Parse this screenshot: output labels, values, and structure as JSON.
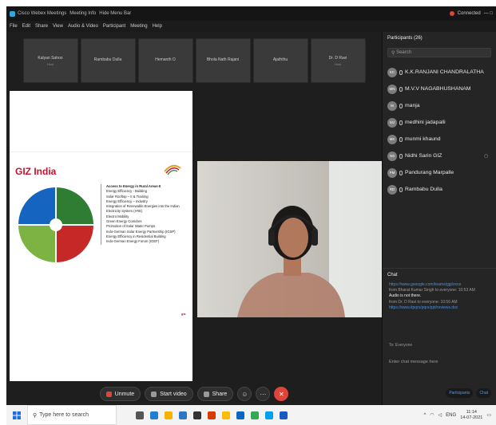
{
  "titlebar": {
    "app_title": "Cisco Webex Meetings",
    "meeting_info": "Meeting Info",
    "hide_menu": "Hide Menu Bar",
    "status": "Connected",
    "controls": "—  □"
  },
  "menu": [
    "File",
    "Edit",
    "Share",
    "View",
    "Audio & Video",
    "Participant",
    "Meeting",
    "Help"
  ],
  "tiles": [
    {
      "name": "Kalyan Sahoo",
      "sub": "Host"
    },
    {
      "name": "Rambabu Dulla",
      "sub": ""
    },
    {
      "name": "Hemanth O",
      "sub": ""
    },
    {
      "name": "Bhola Nath Rajani",
      "sub": ""
    },
    {
      "name": "Ajaththu",
      "sub": ""
    },
    {
      "name": "Dr. D Ravi",
      "sub": "Host"
    }
  ],
  "slide": {
    "title": "GIZ India",
    "bullets": [
      "Access to Energy in Rural Areas-II",
      "Energy Efficiency - Building",
      "Solar Rooftop – II & Training",
      "Energy Efficiency – Industry",
      "Integration of Renewable Energies into the Indian",
      "Electricity System (I-RE)",
      "Electro Mobility",
      "Green Energy Corridors",
      "Promotion of Solar Water Pumps",
      "Indo-German Solar Energy Partnership (IGSP)",
      "Energy Efficiency in Residential Building",
      "Indo-German Energy Forum (IGEF)"
    ],
    "footer_giz": "giz"
  },
  "controls": {
    "unmute": "Unmute",
    "start_video": "Start video",
    "share": "Share",
    "more": "⋯",
    "end": "✕"
  },
  "panel": {
    "participants_header": "Participants (26)",
    "search_placeholder": "Search",
    "participants": [
      {
        "initials": "KC",
        "name": "K.K.RANJANI CHANDRALATHA",
        "extra": ""
      },
      {
        "initials": "MN",
        "name": "M.V.V NAGABHUSHANAM",
        "extra": ""
      },
      {
        "initials": "M",
        "name": "manja",
        "extra": ""
      },
      {
        "initials": "MJ",
        "name": "medhini jadapalli",
        "extra": ""
      },
      {
        "initials": "MK",
        "name": "munmi khaund",
        "extra": ""
      },
      {
        "initials": "NS",
        "name": "Nidhi Sarin GIZ",
        "extra": "▢"
      },
      {
        "initials": "PM",
        "name": "Pandurang Marpalle",
        "extra": ""
      },
      {
        "initials": "RD",
        "name": "Rambabu Dulla",
        "extra": ""
      }
    ],
    "chat_header": "Chat",
    "chat": {
      "link1": "https://www.gooogle.com/teams/ggi/zxce",
      "meta1": "from Bharat Kumar Singh to everyone:   10:53 AM",
      "text1": "Audio is not there.",
      "meta2": "from Dr. D Ravi to everyone:   10:56 AM",
      "link2": "https://www.itpqrs/pqrs/ppt/reviews.doc"
    },
    "chat_to": "To:   Everyone",
    "chat_input_placeholder": "Enter chat message here",
    "btn_participants": "Participants",
    "btn_chat": "Chat"
  },
  "taskbar": {
    "search_placeholder": "Type here to search",
    "lang": "ENG",
    "time": "11:14",
    "date": "14-07-2021"
  }
}
